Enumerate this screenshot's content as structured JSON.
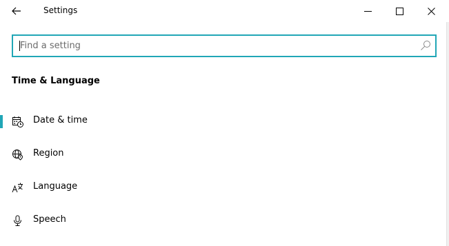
{
  "window": {
    "title": "Settings"
  },
  "search": {
    "placeholder": "Find a setting",
    "value": ""
  },
  "section": {
    "title": "Time & Language"
  },
  "nav": {
    "items": [
      {
        "label": "Date & time",
        "icon": "calendar-clock-icon",
        "selected": true
      },
      {
        "label": "Region",
        "icon": "globe-pin-icon",
        "selected": false
      },
      {
        "label": "Language",
        "icon": "language-icon",
        "selected": false
      },
      {
        "label": "Speech",
        "icon": "microphone-icon",
        "selected": false
      }
    ]
  },
  "colors": {
    "accent": "#20a6b6",
    "background": "#ffffff",
    "text": "#000000",
    "placeholder": "#6b6b6b"
  }
}
